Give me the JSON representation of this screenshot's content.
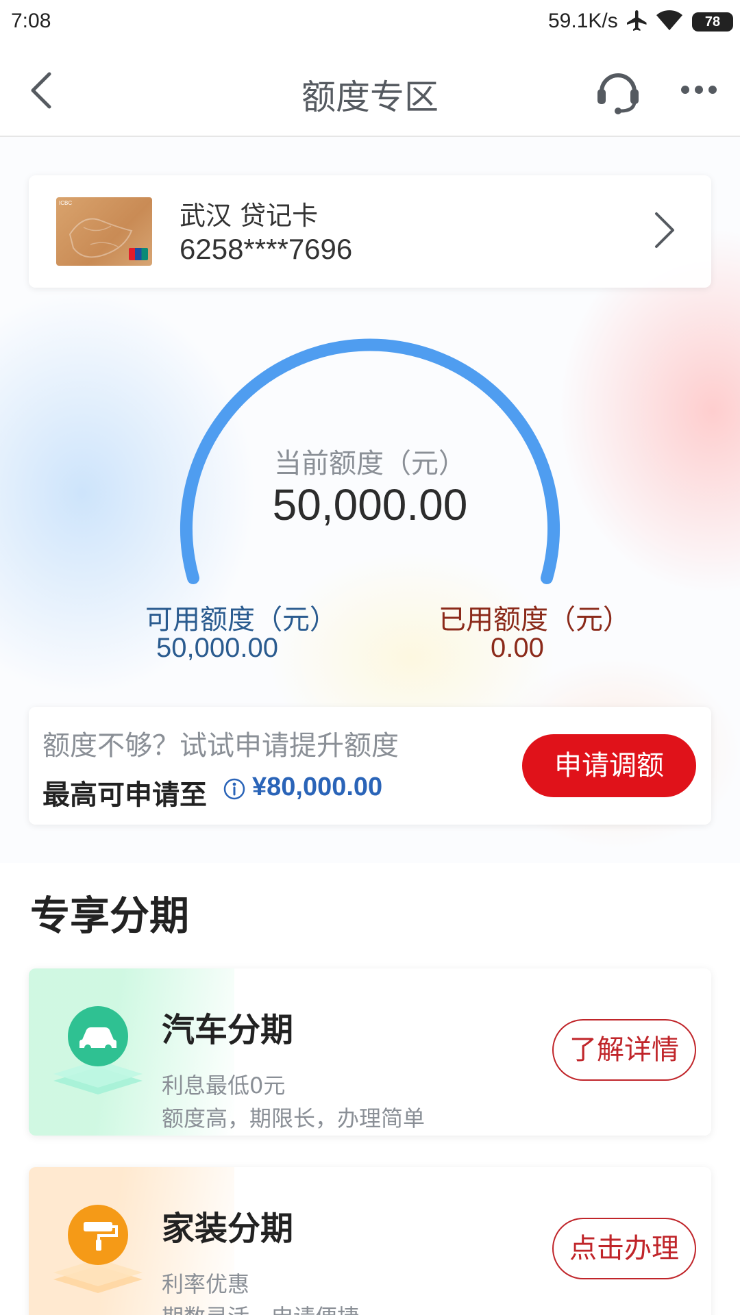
{
  "status_bar": {
    "time": "7:08",
    "speed": "59.1K/s",
    "battery": "78"
  },
  "nav": {
    "title": "额度专区"
  },
  "card": {
    "name": "武汉 贷记卡",
    "number": "6258****7696"
  },
  "gauge": {
    "label": "当前额度（元）",
    "value": "50,000.00",
    "used_fraction": 0.0
  },
  "available": {
    "label": "可用额度（元）",
    "value": "50,000.00"
  },
  "used": {
    "label": "已用额度（元）",
    "value": "0.00"
  },
  "increase": {
    "prompt": "额度不够？试试申请提升额度",
    "max_label": "最高可申请至",
    "max_value": "¥80,000.00",
    "button": "申请调额"
  },
  "section": {
    "title": "专享分期"
  },
  "promos": [
    {
      "title": "汽车分期",
      "line1": "利息最低0元",
      "line2": "额度高，期限长，办理简单",
      "button": "了解详情",
      "icon": "car-icon",
      "accent": "#2fc192"
    },
    {
      "title": "家装分期",
      "line1": "利率优惠",
      "line2": "期数灵活，申请便捷",
      "button": "点击办理",
      "icon": "paint-roller-icon",
      "accent": "#f59a17"
    }
  ],
  "colors": {
    "primary_red": "#e0121a",
    "gauge_blue": "#4f9df0",
    "available_blue": "#2a5b8f",
    "used_red": "#8b2a1a"
  }
}
